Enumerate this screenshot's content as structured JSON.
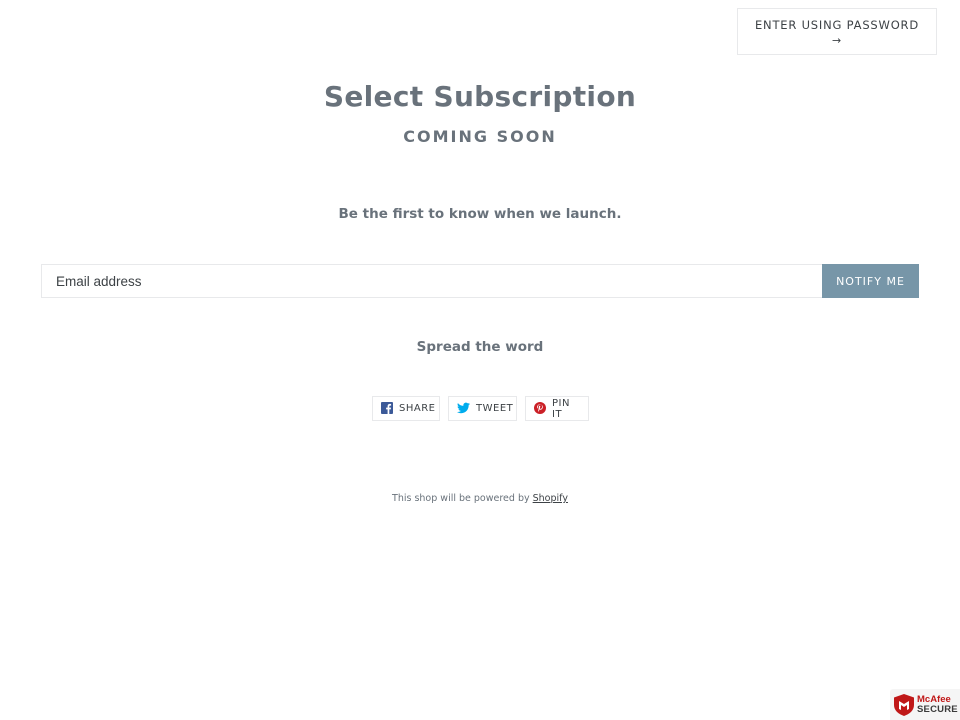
{
  "header": {
    "password_button_label": "ENTER USING PASSWORD",
    "password_button_arrow": "→"
  },
  "main": {
    "title": "Select Subscription",
    "subtitle": "COMING SOON",
    "tagline": "Be the first to know when we launch.",
    "email_placeholder": "Email address",
    "email_value": "",
    "notify_label": "NOTIFY ME",
    "spread_heading": "Spread the word"
  },
  "social": {
    "share_label": "SHARE",
    "tweet_label": "TWEET",
    "pin_label": "PIN IT",
    "icons": [
      "facebook-icon",
      "twitter-icon",
      "pinterest-icon"
    ]
  },
  "footer": {
    "powered_prefix": "This shop will be powered by ",
    "powered_link": "Shopify"
  },
  "badge": {
    "brand": "McAfee",
    "secure": "SECURE"
  },
  "colors": {
    "accent": "#7796a8",
    "text": "#69727b",
    "facebook": "#3b5998",
    "twitter": "#00aced",
    "pinterest": "#cb2027",
    "mcafee_red": "#c01818"
  }
}
